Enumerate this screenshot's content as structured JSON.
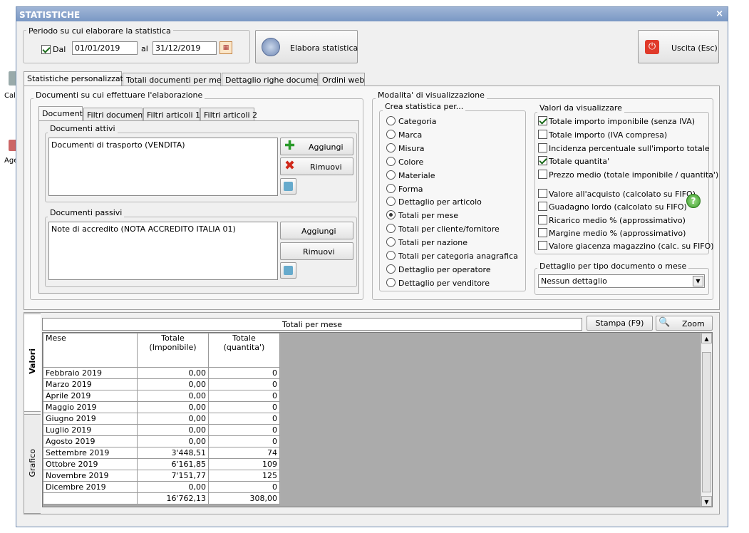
{
  "window": {
    "title": "STATISTICHE",
    "close": "×"
  },
  "desktop": {
    "label1": "Cal",
    "label2": "Age"
  },
  "period": {
    "legend": "Periodo su cui elaborare la statistica",
    "dal_label": "Dal",
    "from": "01/01/2019",
    "al_label": "al",
    "to": "31/12/2019"
  },
  "buttons": {
    "elabora": "Elabora statistica",
    "uscita": "Uscita (Esc)",
    "aggiungi": "Aggiungi",
    "rimuovi": "Rimuovi",
    "stampa": "Stampa (F9)",
    "zoom": "Zoom"
  },
  "main_tabs": [
    "Statistiche personalizzate",
    "Totali documenti per mese",
    "Dettaglio righe documenti",
    "Ordini web"
  ],
  "docs": {
    "legend": "Documenti su cui effettuare l'elaborazione",
    "tabs": [
      "Documenti",
      "Filtri documenti",
      "Filtri articoli 1",
      "Filtri articoli 2"
    ],
    "attivi_legend": "Documenti attivi",
    "attivi_item": "Documenti di trasporto (VENDITA)",
    "passivi_legend": "Documenti passivi",
    "passivi_item": "Note di accredito (NOTA ACCREDITO ITALIA 01)"
  },
  "vis": {
    "legend": "Modalita' di visualizzazione",
    "crea_legend": "Crea statistica per...",
    "options": [
      "Categoria",
      "Marca",
      "Misura",
      "Colore",
      "Materiale",
      "Forma",
      "Dettaglio per articolo",
      "Totali per mese",
      "Totali per cliente/fornitore",
      "Totali per nazione",
      "Totali per categoria anagrafica",
      "Dettaglio per operatore",
      "Dettaglio per venditore"
    ],
    "selected": "Totali per mese",
    "valori_legend": "Valori da visualizzare",
    "valori": [
      "Totale importo imponibile (senza IVA)",
      "Totale importo (IVA compresa)",
      "Incidenza percentuale sull'importo totale",
      "Totale quantita'",
      "Prezzo medio (totale imponibile / quantita')"
    ],
    "valori2": [
      "Valore all'acquisto (calcolato su FIFO)",
      "Guadagno lordo (calcolato su FIFO)",
      "Ricarico medio % (approssimativo)",
      "Margine medio % (approssimativo)",
      "Valore giacenza magazzino (calc. su FIFO)"
    ],
    "dettaglio_legend": "Dettaglio per tipo documento o mese",
    "dettaglio_value": "Nessun dettaglio"
  },
  "results": {
    "title": "Totali per mese",
    "side_tabs": [
      "Valori",
      "Grafico"
    ],
    "headers": {
      "mese": "Mese",
      "imp1": "Totale",
      "imp2": "(Imponibile)",
      "qta1": "Totale",
      "qta2": "(quantita')"
    },
    "rows": [
      [
        "Febbraio 2019",
        "0,00",
        "0"
      ],
      [
        "Marzo 2019",
        "0,00",
        "0"
      ],
      [
        "Aprile 2019",
        "0,00",
        "0"
      ],
      [
        "Maggio 2019",
        "0,00",
        "0"
      ],
      [
        "Giugno 2019",
        "0,00",
        "0"
      ],
      [
        "Luglio 2019",
        "0,00",
        "0"
      ],
      [
        "Agosto 2019",
        "0,00",
        "0"
      ],
      [
        "Settembre 2019",
        "3'448,51",
        "74"
      ],
      [
        "Ottobre 2019",
        "6'161,85",
        "109"
      ],
      [
        "Novembre 2019",
        "7'151,77",
        "125"
      ],
      [
        "Dicembre 2019",
        "0,00",
        "0"
      ]
    ],
    "total": [
      "",
      "16'762,13",
      "308,00"
    ]
  },
  "colors": {
    "titlebar": "#7a98c4",
    "grid_bg": "#ababab"
  }
}
